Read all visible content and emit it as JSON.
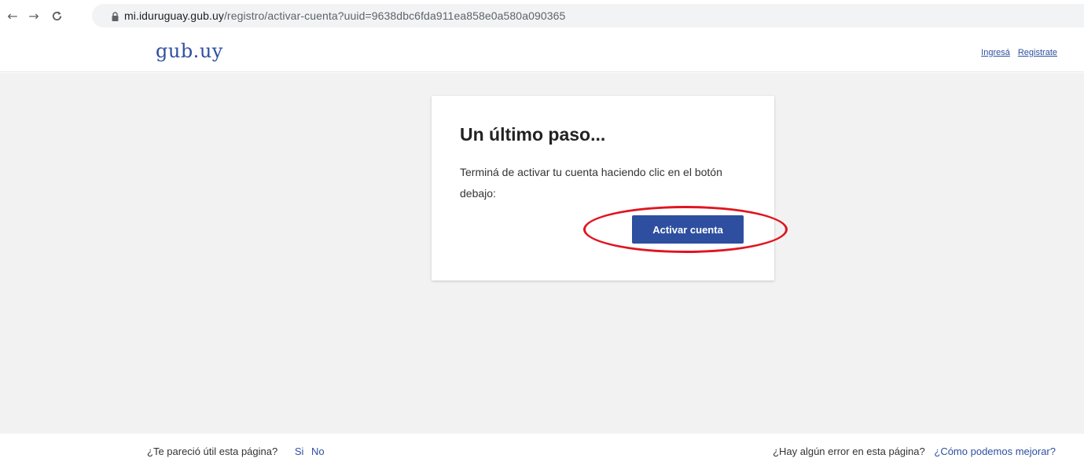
{
  "browser": {
    "url_host": "mi.iduruguay.gub.uy",
    "url_path": "/registro/activar-cuenta?uuid=9638dbc6fda911ea858e0a580a090365",
    "back_icon": "arrow-left-icon",
    "forward_icon": "arrow-right-icon",
    "reload_icon": "reload-icon",
    "lock_icon": "lock-icon"
  },
  "header": {
    "logo": "gub.uy",
    "login_link": "Ingresá",
    "register_link": "Registrate"
  },
  "card": {
    "title": "Un último paso...",
    "text": "Terminá de activar tu cuenta haciendo clic en el botón debajo:",
    "button_label": "Activar cuenta"
  },
  "footer": {
    "useful_question": "¿Te pareció útil esta página?",
    "yes": "Si",
    "no": "No",
    "error_question": "¿Hay algún error en esta página?",
    "improve_link": "¿Cómo podemos mejorar?"
  },
  "colors": {
    "brand": "#2e4fa0",
    "highlight": "#e1141f",
    "background": "#f2f2f2"
  }
}
